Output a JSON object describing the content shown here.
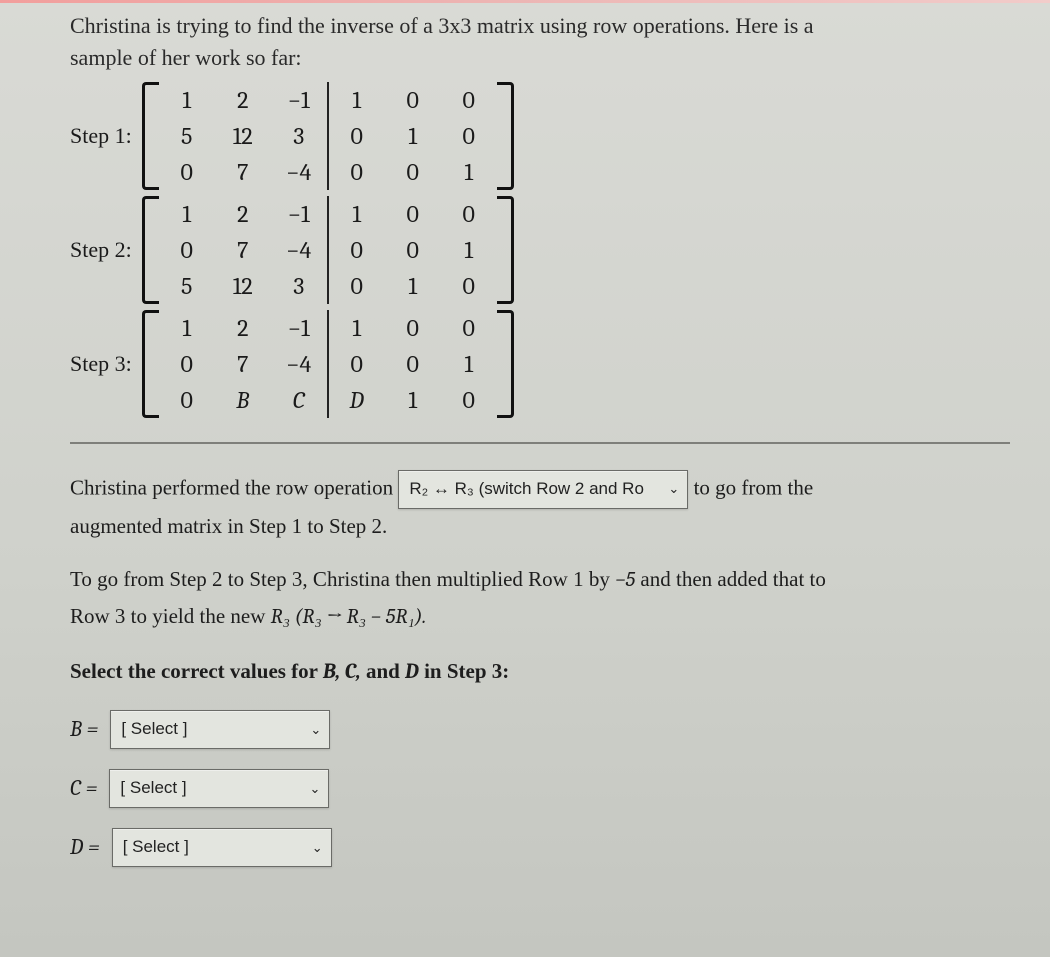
{
  "intro1": "Christina is trying to find the inverse of a 3x3 matrix using row operations. Here is a",
  "intro2": "sample of her work so far:",
  "steps": [
    {
      "label": "Step 1:",
      "rows": [
        [
          "1",
          "2",
          "−1",
          "1",
          "0",
          "0"
        ],
        [
          "5",
          "12",
          "3",
          "0",
          "1",
          "0"
        ],
        [
          "0",
          "7",
          "−4",
          "0",
          "0",
          "1"
        ]
      ]
    },
    {
      "label": "Step 2:",
      "rows": [
        [
          "1",
          "2",
          "−1",
          "1",
          "0",
          "0"
        ],
        [
          "0",
          "7",
          "−4",
          "0",
          "0",
          "1"
        ],
        [
          "5",
          "12",
          "3",
          "0",
          "1",
          "0"
        ]
      ]
    },
    {
      "label": "Step 3:",
      "rows": [
        [
          "1",
          "2",
          "−1",
          "1",
          "0",
          "0"
        ],
        [
          "0",
          "7",
          "−4",
          "0",
          "0",
          "1"
        ],
        [
          "0",
          "B",
          "C",
          "D",
          "1",
          "0"
        ]
      ]
    }
  ],
  "q1_a": "Christina performed the row operation ",
  "q1_sel": "R₂ ↔ R₃ (switch Row 2 and Ro",
  "q1_b": " to go from the",
  "q1_c": "augmented matrix in Step 1 to Step 2.",
  "q2_a": "To go from Step 2 to Step 3, Christina then multiplied Row 1 by ",
  "q2_neg5": "−5",
  "q2_b": " and then added that to",
  "q2_c": "Row 3 to yield the new ",
  "q2_r3": "R₃",
  "q2_paren": " (R₃ → R₃ − 5R₁).",
  "q3": "Select the correct values for ",
  "q3_vars": "B, C,",
  "q3_and": " and ",
  "q3_d": "D",
  "q3_end": " in Step 3:",
  "select_placeholder": "[ Select ]",
  "ans": [
    {
      "v": "B ="
    },
    {
      "v": "C ="
    },
    {
      "v": "D ="
    }
  ]
}
